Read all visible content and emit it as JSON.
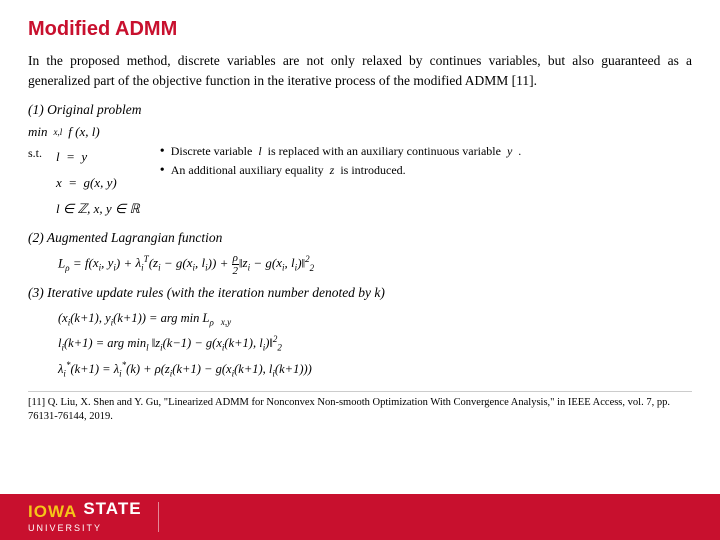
{
  "title": "Modified ADMM",
  "intro": "In the proposed method, discrete variables are not only relaxed by continues variables, but also guaranteed as a generalized part of the objective function in the iterative process of the modified ADMM [11].",
  "sections": {
    "original": {
      "label": "(1) Original problem",
      "st_label": "s.t.",
      "equations": [
        "l  =  y",
        "x  =  g(x, y)",
        "l ∈ ℤ, x, y ∈ ℝ"
      ],
      "bullets": [
        "Discrete variable l is replaced with an auxiliary continuous variable y.",
        "An additional auxiliary equality z is introduced."
      ]
    },
    "augmented": {
      "label": "(2) Augmented Lagrangian function",
      "formula": "Lρ = f(xi, yi) + λiᵀ(zi − g(xi, li)) + (ρ/2)‖zi − g(xi, li)‖²₂"
    },
    "iterative": {
      "label": "(3) Iterative update rules (with the iteration number denoted by k)",
      "formulas": [
        "(xi(k+1), yi(k+1)) = arg min Lρ",
        "                              x,y",
        "li(k+1) = arg min‖zi(k−1) − g(xi(k+1), li)‖²₂",
        "λi*(k+1) = λi*(k) + ρ(zi(k+1) − g(xi(k+1), li(k+1)))"
      ]
    }
  },
  "reference": "[11] Q. Liu, X. Shen and Y. Gu, \"Linearized ADMM for Nonconvex Non-smooth Optimization With Convergence Analysis,\" in IEEE Access, vol. 7, pp. 76131-76144, 2019.",
  "footer": {
    "iowa": "IOWA",
    "state": "STATE",
    "university": "UNIVERSITY"
  }
}
